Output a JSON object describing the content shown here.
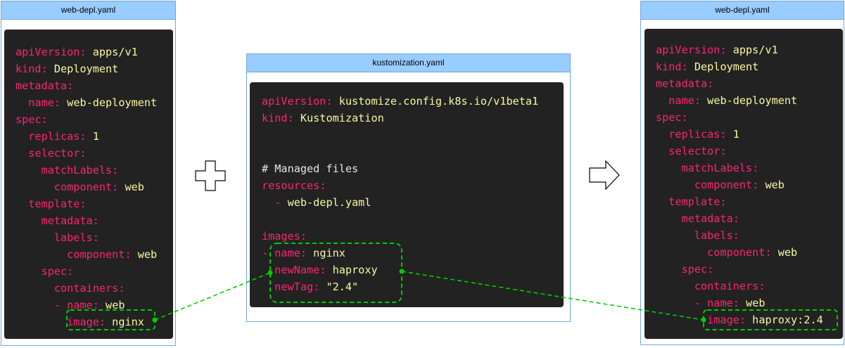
{
  "left": {
    "title": "web-depl.yaml",
    "lines": [
      {
        "indent": "",
        "key": "apiVersion",
        "sep": ": ",
        "value": "apps/v1"
      },
      {
        "indent": "",
        "key": "kind",
        "sep": ": ",
        "value": "Deployment"
      },
      {
        "indent": "",
        "key": "metadata",
        "sep": ":",
        "value": ""
      },
      {
        "indent": "  ",
        "key": "name",
        "sep": ": ",
        "value": "web-deployment"
      },
      {
        "indent": "",
        "key": "spec",
        "sep": ":",
        "value": ""
      },
      {
        "indent": "  ",
        "key": "replicas",
        "sep": ": ",
        "value": "1"
      },
      {
        "indent": "  ",
        "key": "selector",
        "sep": ":",
        "value": ""
      },
      {
        "indent": "    ",
        "key": "matchLabels",
        "sep": ":",
        "value": ""
      },
      {
        "indent": "      ",
        "key": "component",
        "sep": ": ",
        "value": "web"
      },
      {
        "indent": "  ",
        "key": "template",
        "sep": ":",
        "value": ""
      },
      {
        "indent": "    ",
        "key": "metadata",
        "sep": ":",
        "value": ""
      },
      {
        "indent": "      ",
        "key": "labels",
        "sep": ":",
        "value": ""
      },
      {
        "indent": "        ",
        "key": "component",
        "sep": ": ",
        "value": "web"
      },
      {
        "indent": "    ",
        "key": "spec",
        "sep": ":",
        "value": ""
      },
      {
        "indent": "      ",
        "key": "containers",
        "sep": ":",
        "value": ""
      },
      {
        "indent": "      ",
        "key": "- name",
        "sep": ": ",
        "value": "web"
      },
      {
        "indent": "        ",
        "key": "image",
        "sep": ": ",
        "value": "nginx"
      }
    ]
  },
  "middle": {
    "title": "kustomization.yaml",
    "lines": [
      {
        "indent": "",
        "key": "apiVersion",
        "sep": ": ",
        "value": "kustomize.config.k8s.io/v1beta1"
      },
      {
        "indent": "",
        "key": "kind",
        "sep": ": ",
        "value": "Kustomization"
      },
      {
        "indent": "",
        "key": "",
        "sep": "",
        "value": ""
      },
      {
        "indent": "",
        "key": "",
        "sep": "",
        "value": ""
      },
      {
        "indent": "",
        "comment": "# Managed files"
      },
      {
        "indent": "",
        "key": "resources",
        "sep": ":",
        "value": ""
      },
      {
        "indent": "  ",
        "key": "- ",
        "sep": "",
        "value": "web-depl.yaml",
        "dashOnly": true
      },
      {
        "indent": "",
        "key": "",
        "sep": "",
        "value": ""
      },
      {
        "indent": "",
        "key": "images",
        "sep": ":",
        "value": ""
      },
      {
        "indent": "",
        "key": "- name",
        "sep": ": ",
        "value": "nginx"
      },
      {
        "indent": "  ",
        "key": "newName",
        "sep": ": ",
        "value": "haproxy"
      },
      {
        "indent": "  ",
        "key": "newTag",
        "sep": ": ",
        "value": "\"2.4\""
      }
    ]
  },
  "right": {
    "title": "web-depl.yaml",
    "lines": [
      {
        "indent": "",
        "key": "apiVersion",
        "sep": ": ",
        "value": "apps/v1"
      },
      {
        "indent": "",
        "key": "kind",
        "sep": ": ",
        "value": "Deployment"
      },
      {
        "indent": "",
        "key": "metadata",
        "sep": ":",
        "value": ""
      },
      {
        "indent": "  ",
        "key": "name",
        "sep": ": ",
        "value": "web-deployment"
      },
      {
        "indent": "",
        "key": "spec",
        "sep": ":",
        "value": ""
      },
      {
        "indent": "  ",
        "key": "replicas",
        "sep": ": ",
        "value": "1"
      },
      {
        "indent": "  ",
        "key": "selector",
        "sep": ":",
        "value": ""
      },
      {
        "indent": "    ",
        "key": "matchLabels",
        "sep": ":",
        "value": ""
      },
      {
        "indent": "      ",
        "key": "component",
        "sep": ": ",
        "value": "web"
      },
      {
        "indent": "  ",
        "key": "template",
        "sep": ":",
        "value": ""
      },
      {
        "indent": "    ",
        "key": "metadata",
        "sep": ":",
        "value": ""
      },
      {
        "indent": "      ",
        "key": "labels",
        "sep": ":",
        "value": ""
      },
      {
        "indent": "        ",
        "key": "component",
        "sep": ": ",
        "value": "web"
      },
      {
        "indent": "    ",
        "key": "spec",
        "sep": ":",
        "value": ""
      },
      {
        "indent": "      ",
        "key": "containers",
        "sep": ":",
        "value": ""
      },
      {
        "indent": "      ",
        "key": "- name",
        "sep": ": ",
        "value": "web"
      },
      {
        "indent": "        ",
        "key": "image",
        "sep": ": ",
        "value": "haproxy:2.4"
      }
    ]
  },
  "colors": {
    "key": "#f92672",
    "value": "#f8f8a2",
    "comment": "#e6e6e6",
    "code_bg": "#222222",
    "header_bg": "#99ccff",
    "border": "#6fa8dc",
    "highlight": "#00cc00"
  },
  "icons": {
    "plus": "plus-icon",
    "arrow": "right-arrow-icon"
  }
}
